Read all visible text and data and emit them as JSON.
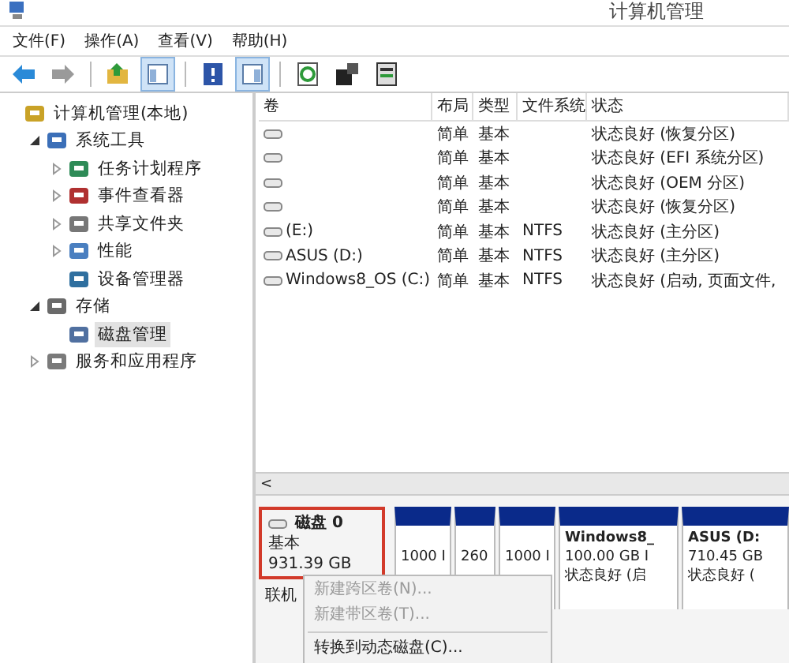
{
  "window": {
    "title": "计算机管理"
  },
  "menu": [
    "文件(F)",
    "操作(A)",
    "查看(V)",
    "帮助(H)"
  ],
  "toolbar": [
    {
      "on": false
    },
    {
      "on": false
    },
    {
      "on": false
    },
    {
      "on": true
    },
    {
      "on": false
    },
    {
      "on": true
    },
    {
      "on": false
    },
    {
      "on": false
    },
    {
      "on": false
    }
  ],
  "tree": [
    {
      "label": "计算机管理(本地)",
      "selected": false,
      "children": [
        {
          "label": "系统工具",
          "expanded": true,
          "selected": false,
          "children": [
            {
              "label": "任务计划程序",
              "expanded": false,
              "selected": false
            },
            {
              "label": "事件查看器",
              "expanded": false,
              "selected": false
            },
            {
              "label": "共享文件夹",
              "expanded": false,
              "selected": false
            },
            {
              "label": "性能",
              "expanded": false,
              "selected": false
            },
            {
              "label": "设备管理器",
              "selected": false
            }
          ]
        },
        {
          "label": "存储",
          "expanded": true,
          "selected": false,
          "children": [
            {
              "label": "磁盘管理",
              "selected": true
            }
          ]
        },
        {
          "label": "服务和应用程序",
          "expanded": false,
          "selected": false
        }
      ]
    }
  ],
  "table": {
    "columns": [
      "卷",
      "布局",
      "类型",
      "文件系统",
      "状态"
    ],
    "rows": [
      {
        "layout": "简单",
        "type": "基本",
        "status": "状态良好 (恢复分区)"
      },
      {
        "layout": "简单",
        "type": "基本",
        "status": "状态良好 (EFI 系统分区)"
      },
      {
        "layout": "简单",
        "type": "基本",
        "status": "状态良好 (OEM 分区)"
      },
      {
        "layout": "简单",
        "type": "基本",
        "status": "状态良好 (恢复分区)"
      },
      {
        "volume": "(E:)",
        "layout": "简单",
        "type": "基本",
        "filesystem": "NTFS",
        "status": "状态良好 (主分区)"
      },
      {
        "volume": "ASUS (D:)",
        "layout": "简单",
        "type": "基本",
        "filesystem": "NTFS",
        "status": "状态良好 (主分区)"
      },
      {
        "volume": "Windows8_OS (C:)",
        "layout": "简单",
        "type": "基本",
        "filesystem": "NTFS",
        "status": "状态良好 (启动, 页面文件,"
      }
    ]
  },
  "scrollbar": {
    "arrow": "<"
  },
  "disk": {
    "name": "磁盘 0",
    "type": "基本",
    "size": "931.39 GB",
    "state": "联机",
    "highlighted": true,
    "partitions": [
      {
        "lines": [
          "1000 I"
        ]
      },
      {
        "lines": [
          "260"
        ]
      },
      {
        "lines": [
          "1000 I"
        ]
      },
      {
        "lines": [
          "Windows8_",
          "100.00 GB I",
          "状态良好 (启"
        ]
      },
      {
        "lines": [
          "ASUS  (D:",
          "710.45 GB",
          "状态良好 ("
        ]
      }
    ]
  },
  "context_menu": [
    {
      "label": "新建跨区卷(N)...",
      "disabled": true
    },
    {
      "label": "新建带区卷(T)...",
      "disabled": true
    },
    {
      "label": "转换到动态磁盘(C)...",
      "disabled": false
    }
  ]
}
